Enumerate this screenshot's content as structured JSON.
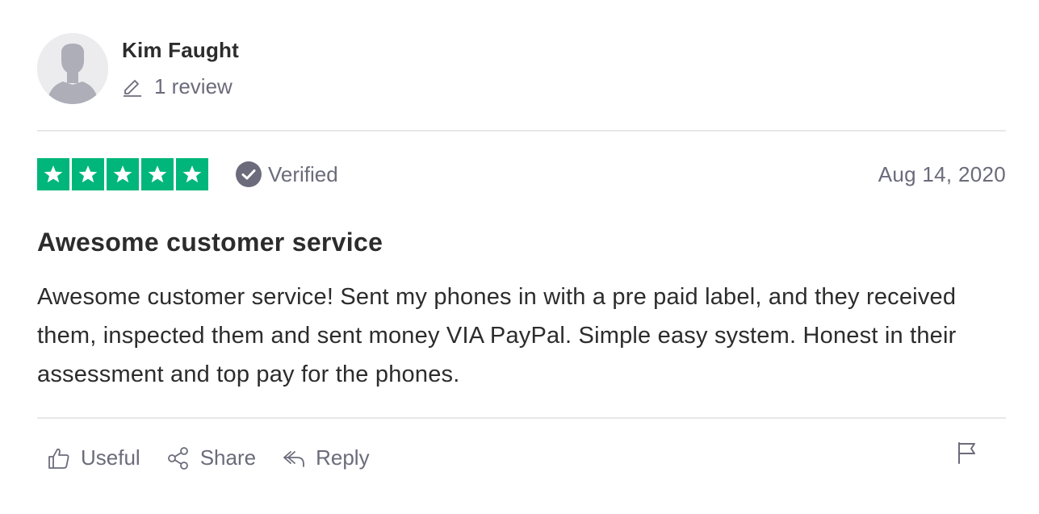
{
  "consumer": {
    "name": "Kim Faught",
    "review_count": "1 review"
  },
  "review": {
    "rating": 5,
    "rating_max": 5,
    "star_color": "#00b67a",
    "verified_label": "Verified",
    "date": "Aug 14, 2020",
    "title": "Awesome customer service",
    "body": "Awesome customer service! Sent my phones in with a pre paid label, and they received them, inspected them and sent money VIA PayPal. Simple easy system. Honest in their assessment and top pay for the phones."
  },
  "actions": {
    "useful_label": "Useful",
    "share_label": "Share",
    "reply_label": "Reply"
  },
  "icons": {
    "avatar": "user-silhouette-icon",
    "review_count": "pencil-icon",
    "verified": "check-circle-icon",
    "useful": "thumbs-up-icon",
    "share": "share-icon",
    "reply": "reply-icon",
    "report": "flag-icon"
  }
}
